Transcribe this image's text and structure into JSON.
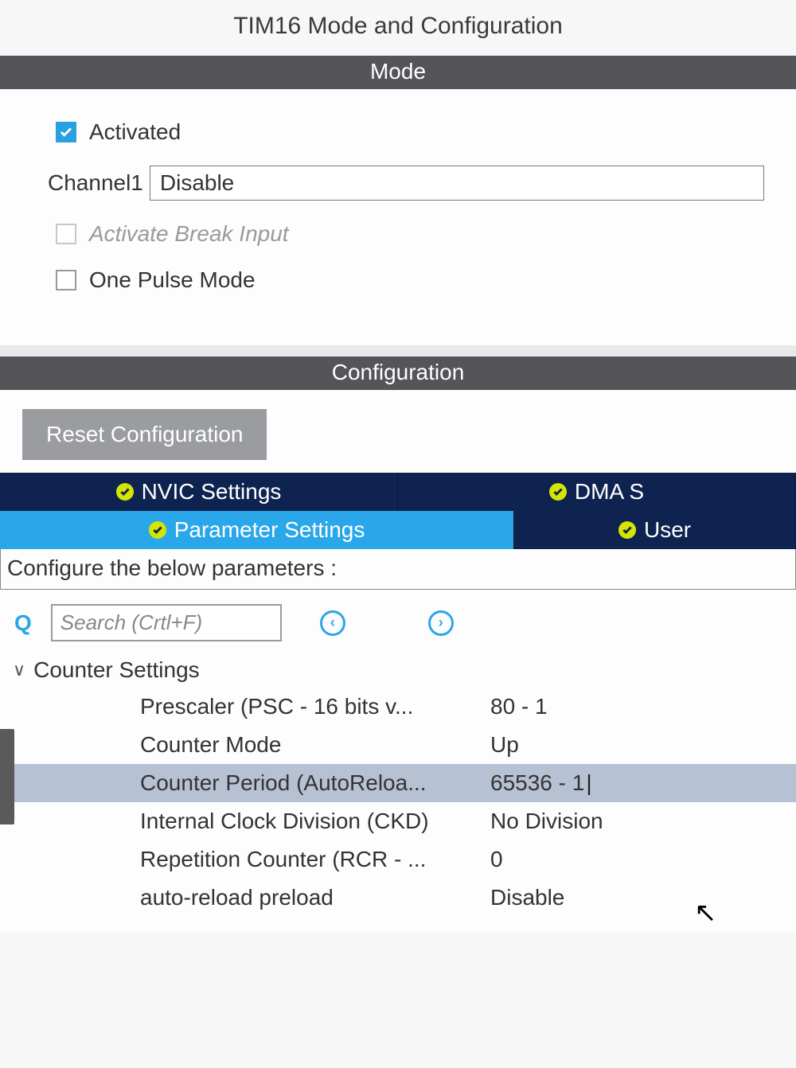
{
  "title": "TIM16 Mode and Configuration",
  "sections": {
    "mode": "Mode",
    "config": "Configuration"
  },
  "mode": {
    "activated": {
      "label": "Activated",
      "checked": true
    },
    "channel1": {
      "label": "Channel1",
      "value": "Disable"
    },
    "break_input": {
      "label": "Activate Break Input",
      "checked": false,
      "disabled": true
    },
    "one_pulse": {
      "label": "One Pulse Mode",
      "checked": false
    }
  },
  "config": {
    "reset_label": "Reset Configuration",
    "tabs_row1": [
      {
        "label": "NVIC Settings"
      },
      {
        "label": "DMA S"
      }
    ],
    "tabs_row2": [
      {
        "label": "Parameter Settings",
        "active": true
      },
      {
        "label": "User "
      }
    ],
    "prompt": "Configure the below parameters :",
    "search_placeholder": "Search (Crtl+F)",
    "group": "Counter Settings",
    "params": [
      {
        "label": "Prescaler (PSC - 16 bits v...",
        "value": "80 - 1"
      },
      {
        "label": "Counter Mode",
        "value": "Up"
      },
      {
        "label": "Counter Period (AutoReloa...",
        "value": "65536 - 1",
        "selected": true
      },
      {
        "label": "Internal Clock Division (CKD)",
        "value": "No Division"
      },
      {
        "label": "Repetition Counter (RCR - ...",
        "value": "0"
      },
      {
        "label": "auto-reload preload",
        "value": "Disable"
      }
    ]
  },
  "colors": {
    "accent": "#2aa6ea",
    "tabdark": "#0f2351"
  }
}
